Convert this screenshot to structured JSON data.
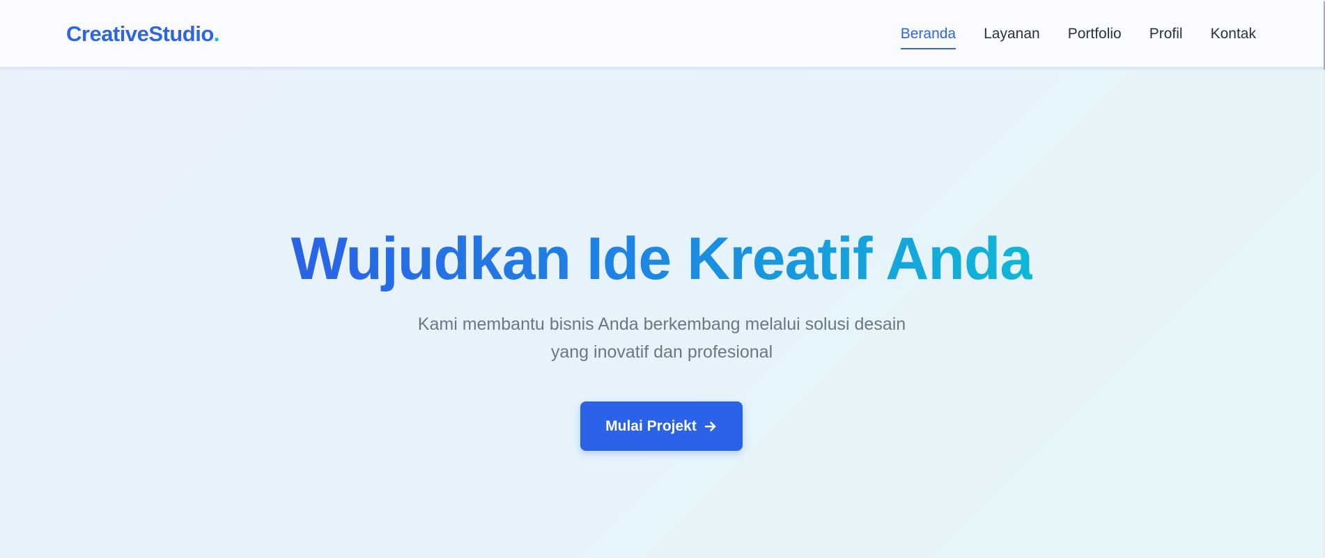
{
  "brand": {
    "name": "CreativeStudio",
    "dot": ".",
    "color": "#2f66d8",
    "dot_color": "#18b4d6"
  },
  "nav": {
    "items": [
      {
        "label": "Beranda",
        "active": true
      },
      {
        "label": "Layanan",
        "active": false
      },
      {
        "label": "Portfolio",
        "active": false
      },
      {
        "label": "Profil",
        "active": false
      },
      {
        "label": "Kontak",
        "active": false
      }
    ]
  },
  "hero": {
    "title": "Wujudkan Ide Kreatif Anda",
    "subtitle": "Kami membantu bisnis Anda berkembang melalui solusi desain yang inovatif dan profesional",
    "cta_label": "Mulai Projekt",
    "cta_icon": "arrow-right-icon",
    "gradient": [
      "#2a62e6",
      "#10b7d6"
    ],
    "button_color": "#2b63e8"
  }
}
